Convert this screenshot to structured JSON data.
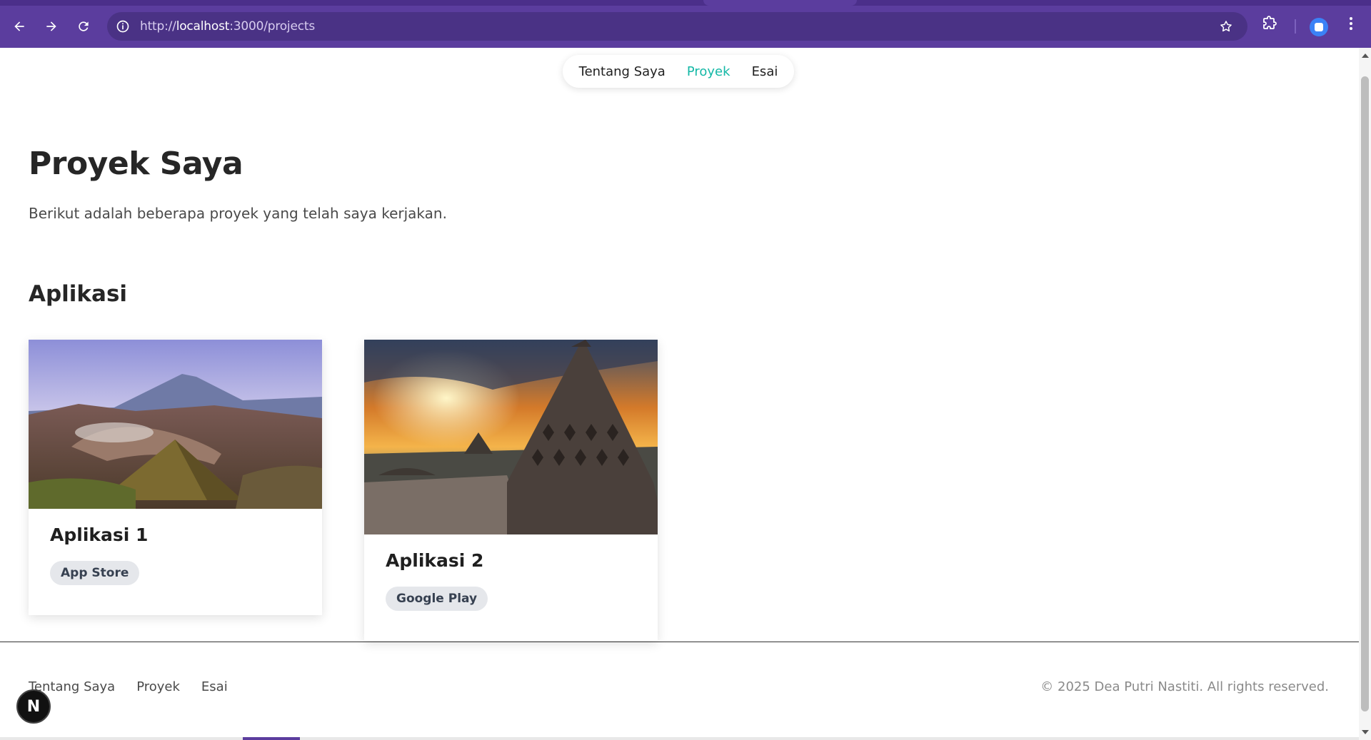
{
  "browser": {
    "url_prefix": "http://",
    "url_host": "localhost",
    "url_rest": ":3000/projects"
  },
  "topnav": {
    "items": [
      {
        "label": "Tentang Saya",
        "active": false
      },
      {
        "label": "Proyek",
        "active": true
      },
      {
        "label": "Esai",
        "active": false
      }
    ]
  },
  "page": {
    "title": "Proyek Saya",
    "subtitle": "Berikut adalah beberapa proyek yang telah saya kerjakan.",
    "section": "Aplikasi"
  },
  "cards": [
    {
      "title": "Aplikasi 1",
      "badge": "App Store",
      "image": "volcano-landscape"
    },
    {
      "title": "Aplikasi 2",
      "badge": "Google Play",
      "image": "temple-stupa-sunset"
    }
  ],
  "footer": {
    "links": [
      "Tentang Saya",
      "Proyek",
      "Esai"
    ],
    "copyright": "© 2025 Dea Putri Nastiti. All rights reserved."
  },
  "devtools": {
    "badge": "N"
  },
  "colors": {
    "accent": "#14b8a6",
    "chrome": "#5b3d9e"
  }
}
